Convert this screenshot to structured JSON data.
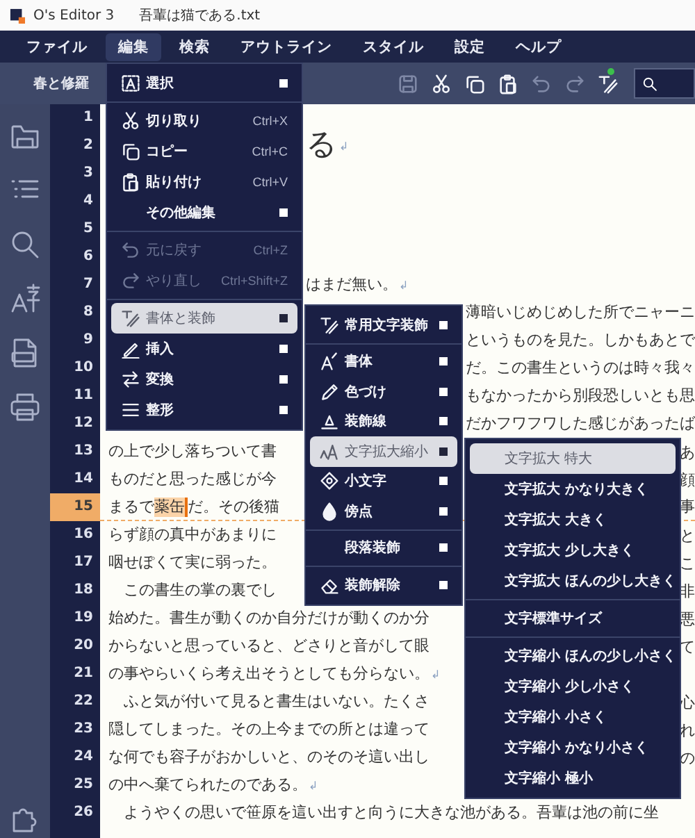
{
  "window": {
    "title": "O's Editor 3",
    "document": "吾輩は猫である.txt"
  },
  "menu_bar": [
    {
      "label": "ファイル",
      "selected": false
    },
    {
      "label": "編集",
      "selected": true
    },
    {
      "label": "検索",
      "selected": false
    },
    {
      "label": "アウトライン",
      "selected": false
    },
    {
      "label": "スタイル",
      "selected": false
    },
    {
      "label": "設定",
      "selected": false
    },
    {
      "label": "ヘルプ",
      "selected": false
    }
  ],
  "toolbar": {
    "document_tab": "春と修羅",
    "buttons": [
      {
        "kind": "save",
        "disabled": true,
        "badge": false
      },
      {
        "kind": "cut",
        "disabled": false,
        "badge": false
      },
      {
        "kind": "copy",
        "disabled": false,
        "badge": false
      },
      {
        "kind": "paste",
        "disabled": false,
        "badge": false
      },
      {
        "kind": "undo",
        "disabled": true,
        "badge": false
      },
      {
        "kind": "redo",
        "disabled": true,
        "badge": false
      },
      {
        "kind": "style-pen",
        "disabled": false,
        "badge": true
      }
    ]
  },
  "sidebar": [
    {
      "kind": "folder"
    },
    {
      "kind": "outline"
    },
    {
      "kind": "search"
    },
    {
      "kind": "text-size"
    },
    {
      "kind": "pdf"
    },
    {
      "kind": "print"
    },
    {
      "kind": "puzzle"
    }
  ],
  "editor": {
    "lines": [
      {
        "kind": "body",
        "number": "1",
        "current": false
      },
      {
        "kind": "heading",
        "number": "2",
        "current": false,
        "text": "る",
        "eol_mark": "↲"
      },
      {
        "kind": "body",
        "number": "3",
        "current": false
      },
      {
        "kind": "body",
        "number": "4",
        "current": false
      },
      {
        "kind": "body",
        "number": "5",
        "current": false
      },
      {
        "kind": "body",
        "number": "6",
        "current": false
      },
      {
        "kind": "body",
        "number": "7",
        "current": false,
        "text": "はまだ無い。",
        "eol_mark": "↲"
      },
      {
        "kind": "body",
        "number": "8",
        "current": false,
        "text": "薄暗いじめじめした所でニャーニ"
      },
      {
        "kind": "body",
        "number": "9",
        "current": false,
        "text": "というものを見た。しかもあとで"
      },
      {
        "kind": "body",
        "number": "10",
        "current": false,
        "text": "だ。この書生というのは時々我々"
      },
      {
        "kind": "body",
        "number": "11",
        "current": false,
        "text": "もなかったから別段恐しいとも思"
      },
      {
        "kind": "body",
        "number": "12",
        "current": false,
        "text": "だかフワフワした感じがあったば"
      },
      {
        "kind": "body",
        "number": "13",
        "current": false,
        "text": "の上で少し落ちついて書",
        "tail": "あ"
      },
      {
        "kind": "body",
        "number": "14",
        "current": false,
        "text": "ものだと思った感じが今",
        "tail": "顔"
      },
      {
        "kind": "body",
        "number": "15",
        "current": true,
        "segments": [
          {
            "text": "まるで",
            "selected": false,
            "caret_after": false
          },
          {
            "text": "薬缶",
            "selected": true,
            "caret_after": true
          },
          {
            "text": "だ。その後猫",
            "selected": false,
            "caret_after": false
          }
        ],
        "tail": "事"
      },
      {
        "kind": "body",
        "number": "16",
        "current": false,
        "text": "らず顔の真中があまりに",
        "tail": "と"
      },
      {
        "kind": "body",
        "number": "17",
        "current": false,
        "text": "咽せぽくて実に弱った。",
        "tail": "こ"
      },
      {
        "kind": "body",
        "number": "18",
        "current": false,
        "text": "　この書生の掌の裏でし",
        "tail": "非"
      },
      {
        "kind": "body",
        "number": "19",
        "current": false,
        "text": "始めた。書生が動くのか自分だけが動くのか分",
        "tail": "悪"
      },
      {
        "kind": "body",
        "number": "20",
        "current": false,
        "text": "からないと思っていると、どさりと音がして眼",
        "tail": "て"
      },
      {
        "kind": "body",
        "number": "21",
        "current": false,
        "text": "の事やらいくら考え出そうとしても分らない。",
        "eol_mark": "↲"
      },
      {
        "kind": "body",
        "number": "22",
        "current": false,
        "text": "　ふと気が付いて見ると書生はいない。たくさ",
        "tail": "心"
      },
      {
        "kind": "body",
        "number": "23",
        "current": false,
        "text": "隠してしまった。その上今までの所とは違って",
        "tail": "れ"
      },
      {
        "kind": "body",
        "number": "24",
        "current": false,
        "text": "な何でも容子がおかしいと、のそのそ這い出し",
        "tail": "の"
      },
      {
        "kind": "body",
        "number": "25",
        "current": false,
        "text": "の中へ棄てられたのである。",
        "eol_mark": "↲"
      },
      {
        "kind": "body",
        "number": "26",
        "current": false,
        "text": "　ようやくの思いで笹原を這い出すと向うに大きな池がある。吾輩は池の前に坐"
      }
    ]
  },
  "menus": [
    {
      "items": [
        {
          "kind": "item",
          "label": "選択",
          "submenu": true,
          "disabled": false,
          "selected": false
        },
        {
          "kind": "separator"
        },
        {
          "kind": "item",
          "label": "切り取り",
          "shortcut": "Ctrl+X",
          "submenu": false,
          "disabled": false,
          "selected": false
        },
        {
          "kind": "item",
          "label": "コピー",
          "shortcut": "Ctrl+C",
          "submenu": false,
          "disabled": false,
          "selected": false
        },
        {
          "kind": "item",
          "label": "貼り付け",
          "shortcut": "Ctrl+V",
          "submenu": false,
          "disabled": false,
          "selected": false
        },
        {
          "kind": "item",
          "label": "その他編集",
          "submenu": true,
          "disabled": false,
          "selected": false
        },
        {
          "kind": "separator"
        },
        {
          "kind": "item",
          "label": "元に戻す",
          "shortcut": "Ctrl+Z",
          "submenu": false,
          "disabled": true,
          "selected": false
        },
        {
          "kind": "item",
          "label": "やり直し",
          "shortcut": "Ctrl+Shift+Z",
          "submenu": false,
          "disabled": true,
          "selected": false
        },
        {
          "kind": "separator"
        },
        {
          "kind": "item",
          "label": "書体と装飾",
          "submenu": true,
          "disabled": false,
          "selected": true
        },
        {
          "kind": "item",
          "label": "挿入",
          "submenu": true,
          "disabled": false,
          "selected": false
        },
        {
          "kind": "item",
          "label": "変換",
          "submenu": true,
          "disabled": false,
          "selected": false
        },
        {
          "kind": "item",
          "label": "整形",
          "submenu": true,
          "disabled": false,
          "selected": false
        }
      ]
    },
    {
      "items": [
        {
          "kind": "item",
          "label": "常用文字装飾",
          "submenu": true,
          "selected": false
        },
        {
          "kind": "separator"
        },
        {
          "kind": "item",
          "label": "書体",
          "submenu": true,
          "selected": false
        },
        {
          "kind": "item",
          "label": "色づけ",
          "submenu": true,
          "selected": false
        },
        {
          "kind": "item",
          "label": "装飾線",
          "submenu": true,
          "selected": false
        },
        {
          "kind": "item",
          "label": "文字拡大縮小",
          "submenu": true,
          "selected": true
        },
        {
          "kind": "item",
          "label": "小文字",
          "submenu": true,
          "selected": false
        },
        {
          "kind": "item",
          "label": "傍点",
          "submenu": true,
          "selected": false
        },
        {
          "kind": "separator"
        },
        {
          "kind": "item",
          "label": "段落装飾",
          "submenu": true,
          "selected": false
        },
        {
          "kind": "separator"
        },
        {
          "kind": "item",
          "label": "装飾解除",
          "submenu": true,
          "selected": false
        }
      ]
    },
    {
      "items": [
        {
          "kind": "item",
          "label": "文字拡大 特大",
          "selected": true
        },
        {
          "kind": "item",
          "label": "文字拡大 かなり大きく",
          "selected": false
        },
        {
          "kind": "item",
          "label": "文字拡大 大きく",
          "selected": false
        },
        {
          "kind": "item",
          "label": "文字拡大 少し大きく",
          "selected": false
        },
        {
          "kind": "item",
          "label": "文字拡大 ほんの少し大きく",
          "selected": false
        },
        {
          "kind": "separator"
        },
        {
          "kind": "item",
          "label": "文字標準サイズ",
          "selected": false
        },
        {
          "kind": "separator"
        },
        {
          "kind": "item",
          "label": "文字縮小 ほんの少し小さく",
          "selected": false
        },
        {
          "kind": "item",
          "label": "文字縮小 少し小さく",
          "selected": false
        },
        {
          "kind": "item",
          "label": "文字縮小 小さく",
          "selected": false
        },
        {
          "kind": "item",
          "label": "文字縮小 かなり小さく",
          "selected": false
        },
        {
          "kind": "item",
          "label": "文字縮小 極小",
          "selected": false
        }
      ]
    }
  ]
}
